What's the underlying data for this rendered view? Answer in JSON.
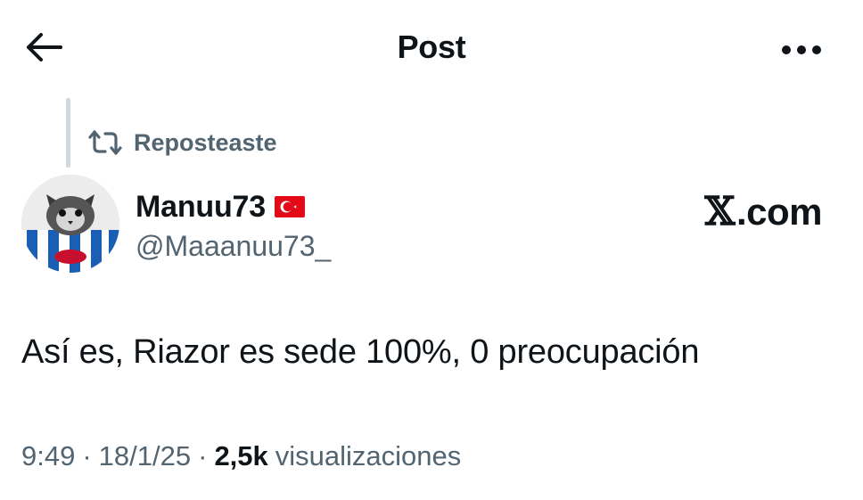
{
  "header": {
    "title": "Post"
  },
  "repost": {
    "label": "Reposteaste"
  },
  "author": {
    "display_name": "Manuu73",
    "handle": "@Maaanuu73_",
    "flag": "turkey-flag-icon"
  },
  "brand": {
    "x": "𝕏",
    "domain": ".com"
  },
  "post": {
    "text": "Así es, Riazor es sede 100%, 0 preocupación"
  },
  "meta": {
    "time": "9:49",
    "sep1": "·",
    "date": "18/1/25",
    "sep2": "·",
    "views_count": "2,5k",
    "views_label": "visualizaciones"
  },
  "colors": {
    "text_primary": "#0f1419",
    "text_secondary": "#536471",
    "thread_line": "#cfd9de",
    "flag_red": "#e30a17"
  }
}
